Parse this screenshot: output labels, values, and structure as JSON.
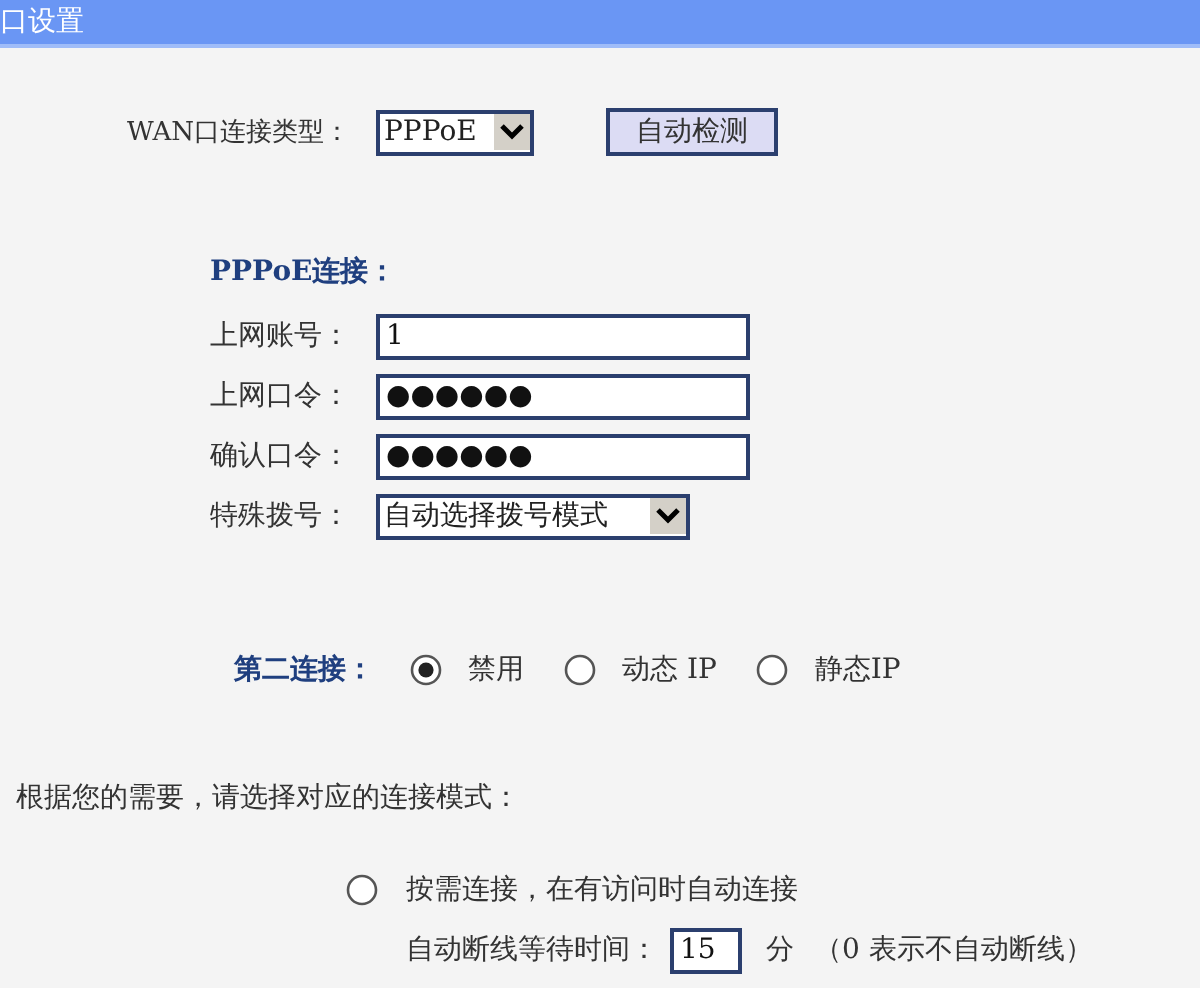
{
  "title_bar": {
    "title": "口设置"
  },
  "wan_type": {
    "label": "WAN口连接类型：",
    "value": "PPPoE",
    "detect_button": "自动检测"
  },
  "pppoe": {
    "heading": "PPPoE连接：",
    "fields": [
      {
        "kind": "text",
        "label": "上网账号：",
        "value": "1"
      },
      {
        "kind": "text",
        "label": "上网口令：",
        "value": "●●●●●●"
      },
      {
        "kind": "text",
        "label": "确认口令：",
        "value": "●●●●●●"
      },
      {
        "kind": "select",
        "label": "特殊拨号：",
        "value": "自动选择拨号模式"
      }
    ]
  },
  "second_connection": {
    "label": "第二连接：",
    "options": [
      {
        "label": "禁用",
        "selected": true
      },
      {
        "label": "动态 IP",
        "selected": false
      },
      {
        "label": "静态IP",
        "selected": false
      }
    ]
  },
  "mode_prompt": "根据您的需要，请选择对应的连接模式：",
  "modes": [
    {
      "label": "按需连接，在有访问时自动连接",
      "selected": false
    }
  ],
  "idle": {
    "label": "自动断线等待时间：",
    "value": "15",
    "unit": "分",
    "note": "（0 表示不自动断线）"
  }
}
